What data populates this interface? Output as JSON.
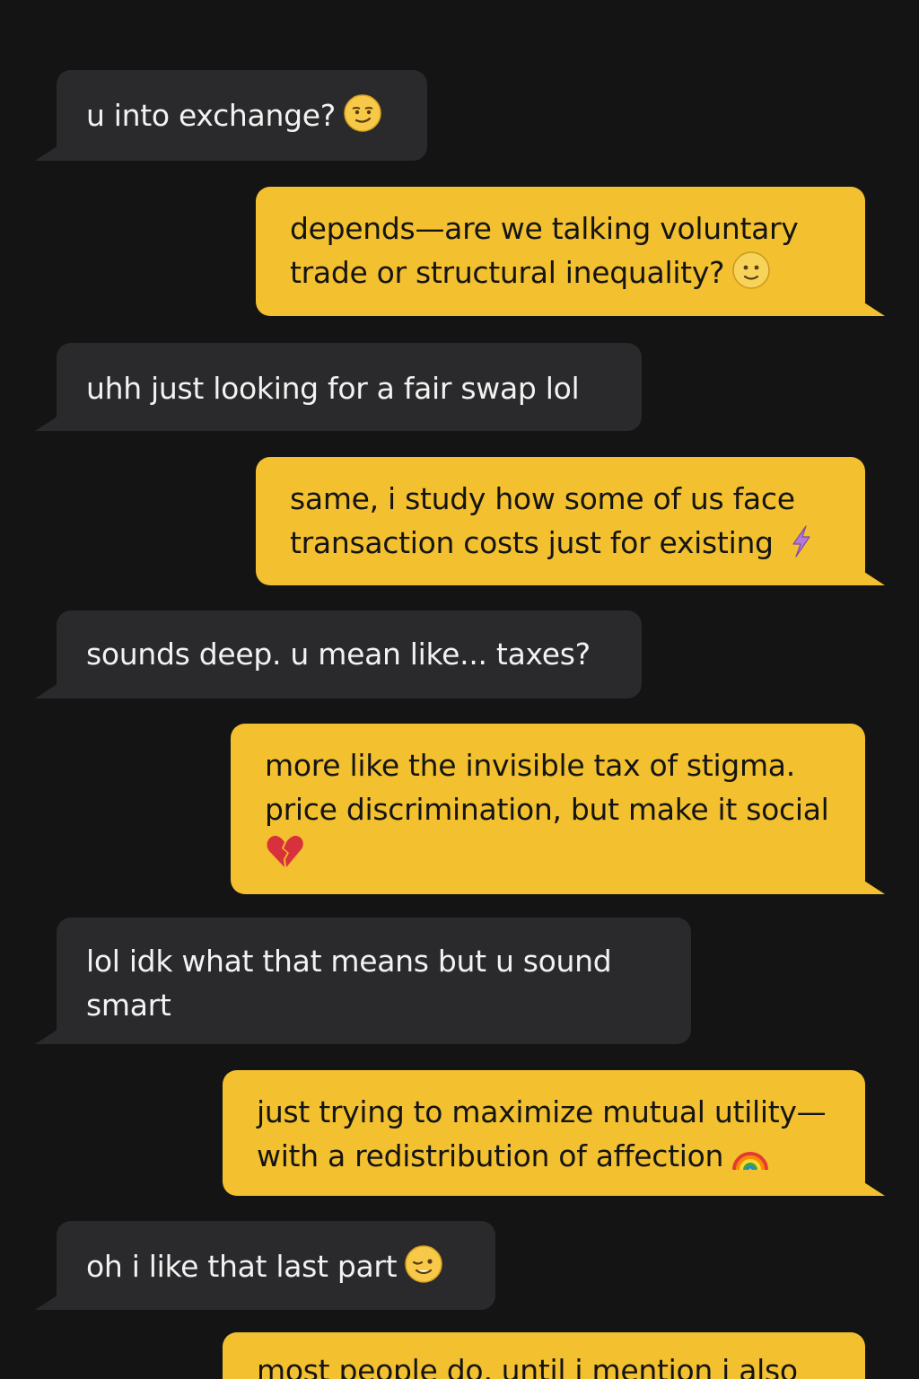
{
  "conversation": {
    "messages": [
      {
        "sender": "them",
        "text": "u into exchange?",
        "emoji": "smirking-face"
      },
      {
        "sender": "me",
        "text": "depends—are we talking voluntary\ntrade or structural inequality?",
        "emoji": "slightly-smiling-face"
      },
      {
        "sender": "them",
        "text": "uhh just looking for a fair swap lol",
        "emoji": ""
      },
      {
        "sender": "me",
        "text": "same, i study how some of us face\ntransaction costs just for existing",
        "emoji": "lightning-bolt"
      },
      {
        "sender": "them",
        "text": "sounds deep. u mean like... taxes?",
        "emoji": ""
      },
      {
        "sender": "me",
        "text": "more like the invisible tax of stigma.\nprice discrimination, but make it social",
        "emoji": "broken-heart"
      },
      {
        "sender": "them",
        "text": "lol idk what that means but u sound\nsmart",
        "emoji": ""
      },
      {
        "sender": "me",
        "text": "just trying to maximize mutual utility—\nwith a redistribution of affection",
        "emoji": "rainbow"
      },
      {
        "sender": "them",
        "text": "oh i like that last part",
        "emoji": "winking-face"
      },
      {
        "sender": "me",
        "text": "most people do, until i mention i also",
        "emoji": ""
      }
    ]
  },
  "colors": {
    "background": "#141414",
    "incoming_bubble": "#2a2a2c",
    "outgoing_bubble": "#f3c02f",
    "incoming_text": "#f2f2f2",
    "outgoing_text": "#141414"
  }
}
